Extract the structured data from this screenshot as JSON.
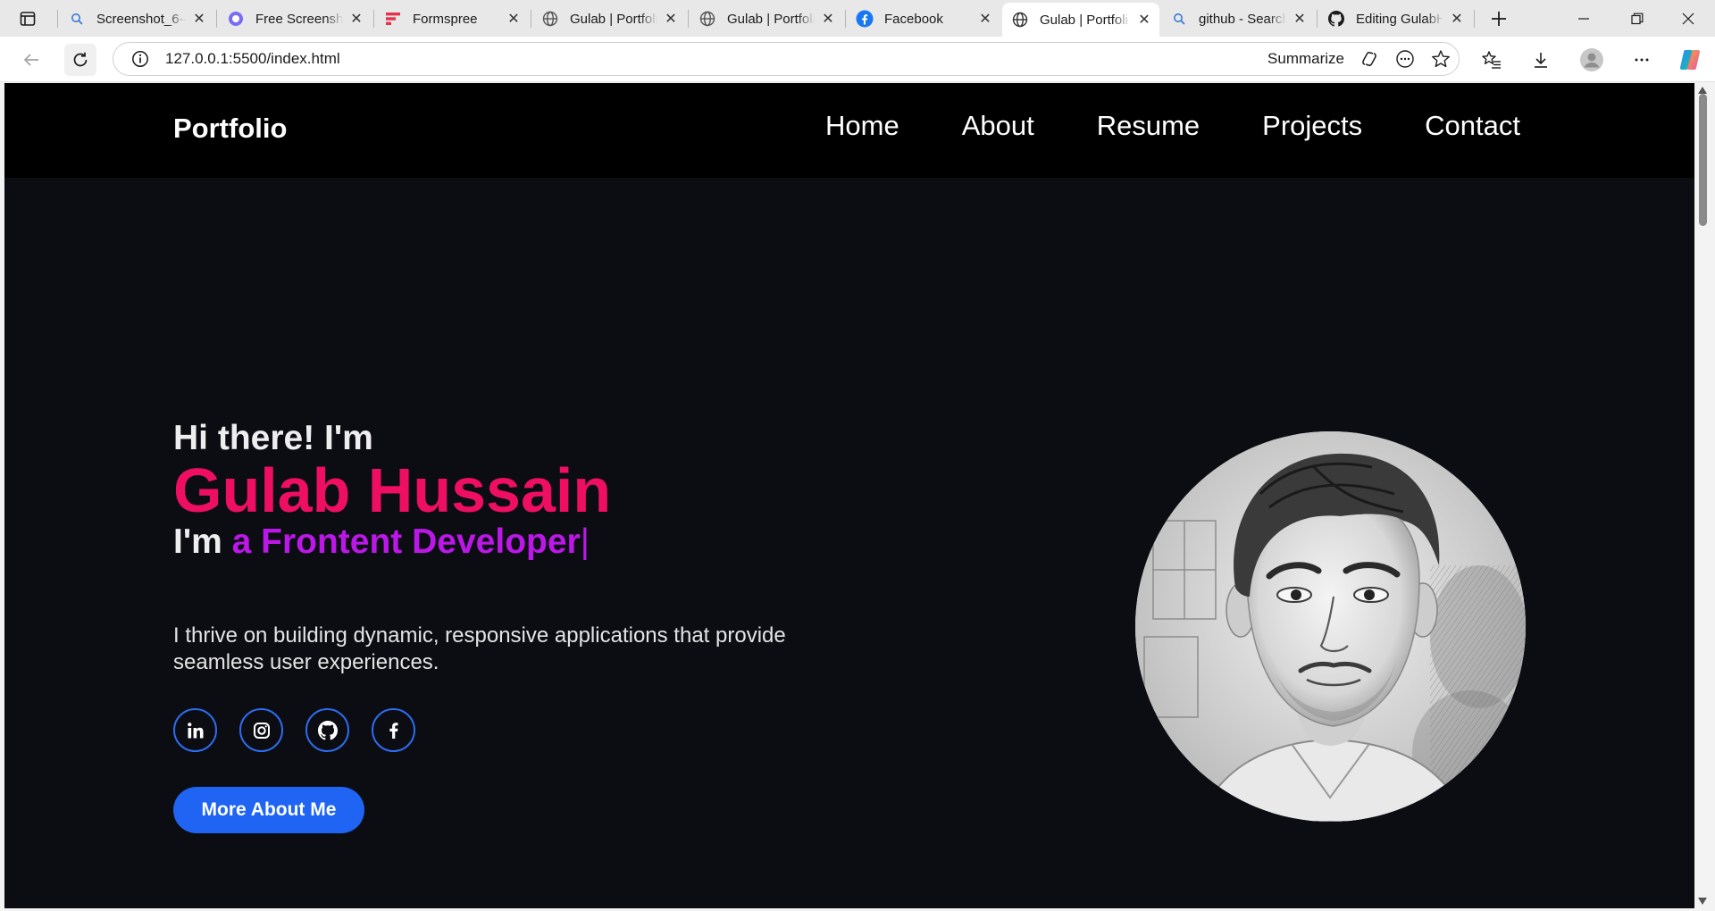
{
  "browser": {
    "tabs": [
      {
        "title": "Screenshot_6-4",
        "icon": "search-icon"
      },
      {
        "title": "Free Screensho",
        "icon": "screenshot-site-icon"
      },
      {
        "title": "Formspree",
        "icon": "formspree-icon"
      },
      {
        "title": "Gulab | Portfoli",
        "icon": "globe-icon"
      },
      {
        "title": "Gulab | Portfoli",
        "icon": "globe-icon"
      },
      {
        "title": "Facebook",
        "icon": "facebook-icon"
      },
      {
        "title": "Gulab | Portfoli",
        "icon": "globe-icon",
        "active": true
      },
      {
        "title": "github - Search",
        "icon": "search-icon"
      },
      {
        "title": "Editing GulabH",
        "icon": "github-icon"
      }
    ],
    "url": "127.0.0.1:5500/index.html",
    "summarize_label": "Summarize"
  },
  "site": {
    "brand": "Portfolio",
    "nav": [
      "Home",
      "About",
      "Resume",
      "Projects",
      "Contact"
    ]
  },
  "hero": {
    "greeting": "Hi there! I'm",
    "name": "Gulab Hussain",
    "role_prefix": "I'm",
    "role_typed": "a Frontent Developer",
    "caret": "|",
    "description": "I thrive on building dynamic, responsive applications that provide seamless user experiences.",
    "socials": [
      "linkedin-icon",
      "instagram-icon",
      "github-icon",
      "facebook-icon"
    ],
    "cta_label": "More About Me"
  },
  "colors": {
    "name": "#ee0e62",
    "role": "#bb18e8",
    "accent": "#1f64f3",
    "background": "#0b0d13"
  }
}
